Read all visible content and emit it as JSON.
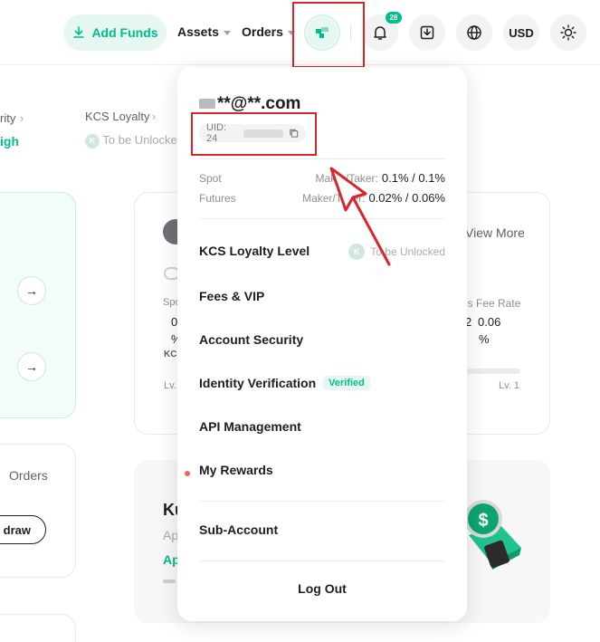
{
  "topbar": {
    "add_funds": "Add Funds",
    "assets": "Assets",
    "orders": "Orders",
    "notification_count": "28",
    "currency": "USD"
  },
  "background": {
    "rity": "rity",
    "loyalty_crumb": "KCS Loyalty",
    "igh": "igh",
    "to_be_unlocked": "To be Unlocked",
    "view_more": "View More",
    "spot_partial": "Spo",
    "spot_val_partial": "0",
    "pct": "%",
    "kc_partial": "KC",
    "lv_left": "Lv.",
    "fee_rate_partial": "es Fee Rate",
    "fee_2": "2",
    "fee_006": "0.06",
    "fee_pct": "%",
    "lv1": "Lv. 1",
    "orders": "Orders",
    "withdraw_partial": "draw",
    "ku_partial": "Ku",
    "ap_partial": "Ap",
    "ap_green_partial": "Ap"
  },
  "dropdown": {
    "email": "**@**.com",
    "uid": "UID: 24",
    "spot_label": "Spot",
    "futures_label": "Futures",
    "maker_taker_label": "Maker/Taker:",
    "spot_fee": "0.1% / 0.1%",
    "futures_fee": "0.02% / 0.06%",
    "loyalty_level": "KCS Loyalty Level",
    "loyalty_status": "To be Unlocked",
    "fees_vip": "Fees & VIP",
    "account_security": "Account Security",
    "identity_verification": "Identity Verification",
    "verified": "Verified",
    "api_management": "API Management",
    "my_rewards": "My Rewards",
    "sub_account": "Sub-Account",
    "log_out": "Log Out"
  },
  "colors": {
    "accent": "#01bc8d",
    "highlight_box": "#d9252b",
    "reward_dot": "#f0674b"
  }
}
